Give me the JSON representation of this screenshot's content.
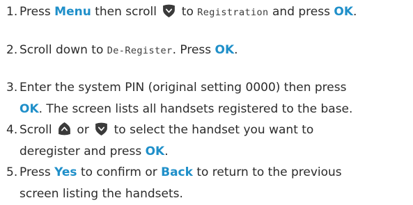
{
  "steps": [
    {
      "number": "1.",
      "line1": {
        "a": "Press ",
        "key_menu": "Menu",
        "b": " then scroll ",
        "icon": "scroll-down-icon",
        "c": " to ",
        "lcd": "Registration",
        "d": " and press ",
        "key_ok": "OK",
        "e": "."
      }
    },
    {
      "number": "2.",
      "line1": {
        "a": "Scroll down to ",
        "lcd": "De-Register",
        "b": ". Press ",
        "key_ok": "OK",
        "c": "."
      }
    },
    {
      "number": "3.",
      "line1": "Enter the system PIN (original setting 0000) then press",
      "line2": {
        "key_ok": "OK",
        "a": ". The screen lists all handsets registered to the base."
      }
    },
    {
      "number": "4.",
      "line1": {
        "a": "Scroll ",
        "icon_up": "scroll-up-icon",
        "b": " or ",
        "icon_down": "scroll-down-icon",
        "c": " to select the handset you want to"
      },
      "line2": {
        "a": "deregister and press ",
        "key_ok": "OK",
        "b": "."
      }
    },
    {
      "number": "5.",
      "line1": {
        "a": "Press ",
        "key_yes": "Yes",
        "b": " to confirm or ",
        "key_back": "Back",
        "c": " to return to the previous"
      },
      "line2": "screen listing the handsets."
    }
  ],
  "colors": {
    "text": "#2b2b2b",
    "keyword": "#1f8fc9",
    "icon": "#3a3a3a"
  }
}
